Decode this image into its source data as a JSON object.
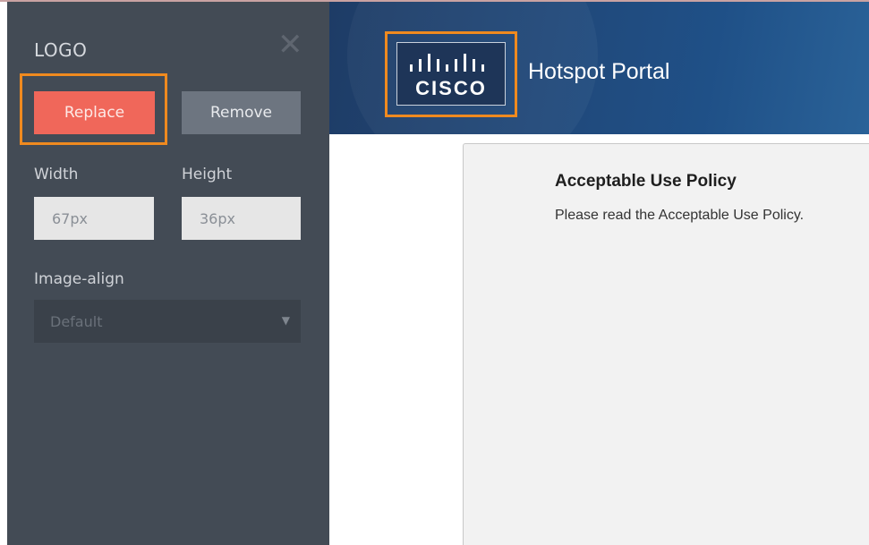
{
  "editor": {
    "title": "LOGO",
    "close_icon": "close-icon",
    "replace_label": "Replace",
    "remove_label": "Remove",
    "width_label": "Width",
    "width_value": "67px",
    "height_label": "Height",
    "height_value": "36px",
    "image_align_label": "Image-align",
    "image_align_value": "Default"
  },
  "portal": {
    "logo_text": "CISCO",
    "title": "Hotspot Portal",
    "content_title": "Acceptable Use Policy",
    "content_text": "Please read the Acceptable Use Policy."
  },
  "colors": {
    "highlight": "#f08a1f",
    "replace_button": "#f0675a",
    "panel_bg": "#434b55",
    "header_bg": "#214879"
  }
}
